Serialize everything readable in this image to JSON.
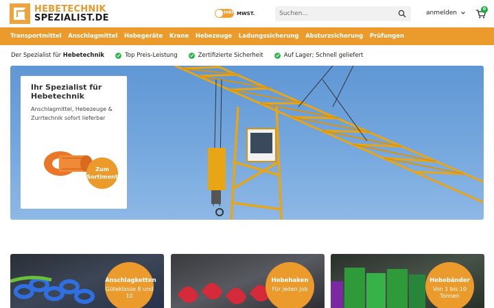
{
  "header": {
    "logo_line1": "HEBETECHNIK",
    "logo_line2": "SPEZIALIST.DE",
    "vat_toggle_state": "inkl.",
    "vat_label": "MWST.",
    "search_placeholder": "Suchen...",
    "login_label": "anmelden",
    "cart_count": "0"
  },
  "nav": {
    "items": [
      "Transportmittel",
      "Anschlagmittel",
      "Hebegeräte",
      "Krane",
      "Hebezeuge",
      "Ladungssicherung",
      "Absturzsicherung",
      "Prüfungen"
    ]
  },
  "usp": {
    "intro_prefix": "Der Spezialist für ",
    "intro_bold": "Hebetechnik",
    "items": [
      "Top Preis-Leistung",
      "Zertifizierte Sicherheit",
      "Auf Lager; Schnell geliefert"
    ]
  },
  "hero": {
    "title": "Ihr Spezialist für Hebetechnik",
    "text": "Anschlagmittel, Hebezeuge & Zurrtechnik sofort lieferbar",
    "cta": "Zum Sortiment"
  },
  "categories": [
    {
      "title": "Anschlagketten",
      "subtitle": "Güteklasse 8 und 10"
    },
    {
      "title": "Hebehaken",
      "subtitle": "Für jeden Job"
    },
    {
      "title": "Hebebänder",
      "subtitle": "Von 1 bis 10 Tonnen"
    }
  ],
  "colors": {
    "accent": "#ea9b2c",
    "success": "#2cb64a",
    "sky": "#6fa3dc"
  }
}
